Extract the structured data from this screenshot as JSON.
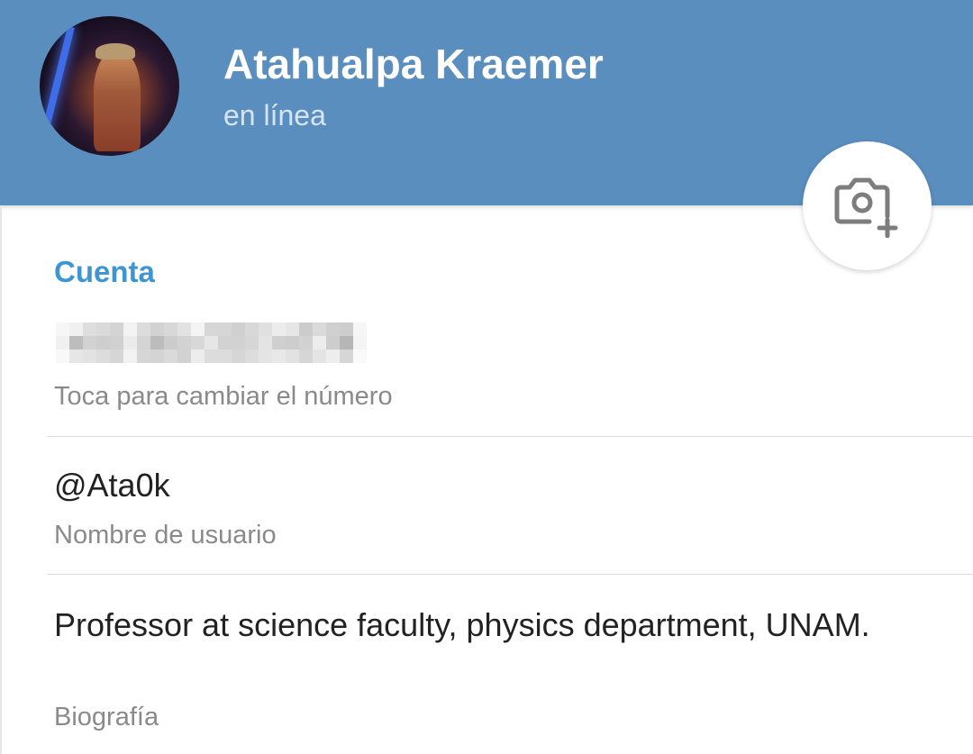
{
  "profile": {
    "name": "Atahualpa Kraemer",
    "status": "en línea"
  },
  "account": {
    "section_title": "Cuenta",
    "phone_hint": "Toca para cambiar el número",
    "username": "@Ata0k",
    "username_hint": "Nombre de usuario",
    "bio": "Professor at science faculty, physics department, UNAM.",
    "bio_hint": "Biografía"
  },
  "colors": {
    "header": "#5a8ebe",
    "accent": "#3d95d3"
  },
  "icons": {
    "set_photo": "camera-add-icon"
  }
}
